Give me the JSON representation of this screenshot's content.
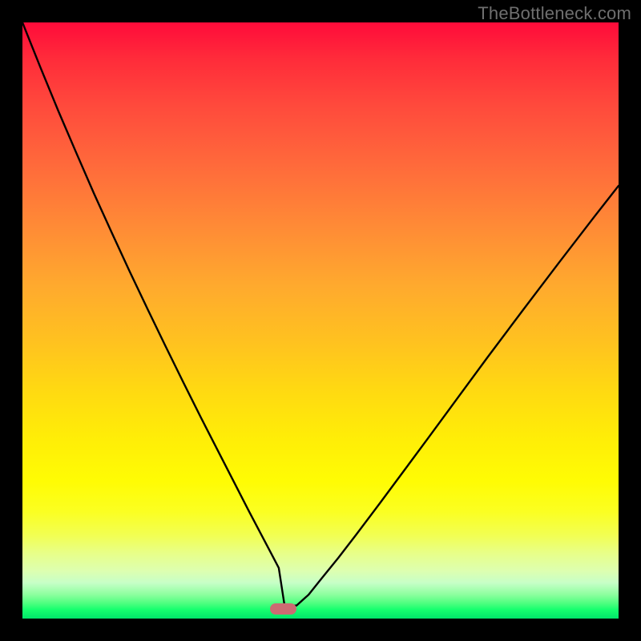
{
  "watermark": {
    "text": "TheBottleneck.com"
  },
  "chart_data": {
    "type": "line",
    "title": "",
    "xlabel": "",
    "ylabel": "",
    "xlim": [
      0,
      100
    ],
    "ylim": [
      0,
      100
    ],
    "grid": false,
    "legend": false,
    "series": [
      {
        "name": "bottleneck-curve",
        "x": [
          0,
          3,
          6,
          9,
          12,
          15,
          18,
          21,
          24,
          27,
          30,
          32,
          34,
          36,
          38,
          40,
          41,
          42,
          43,
          44,
          46,
          48,
          50,
          53,
          56,
          60,
          64,
          68,
          73,
          78,
          84,
          90,
          96,
          100
        ],
        "y": [
          100,
          92.5,
          85.2,
          78.2,
          71.3,
          64.7,
          58.2,
          51.9,
          45.7,
          39.6,
          33.6,
          29.7,
          25.8,
          21.9,
          18.0,
          14.2,
          12.3,
          10.4,
          8.5,
          2.0,
          2.2,
          4.0,
          6.5,
          10.2,
          14.1,
          19.4,
          24.8,
          30.2,
          37.0,
          43.8,
          51.8,
          59.7,
          67.5,
          72.6
        ]
      }
    ],
    "marker": {
      "x_start": 41.5,
      "x_end": 46.0,
      "y": 1.6,
      "color": "#cc6b72"
    },
    "background_gradient": {
      "top": "#ff0b3a",
      "mid": "#ffee07",
      "bottom": "#00e56a"
    }
  }
}
